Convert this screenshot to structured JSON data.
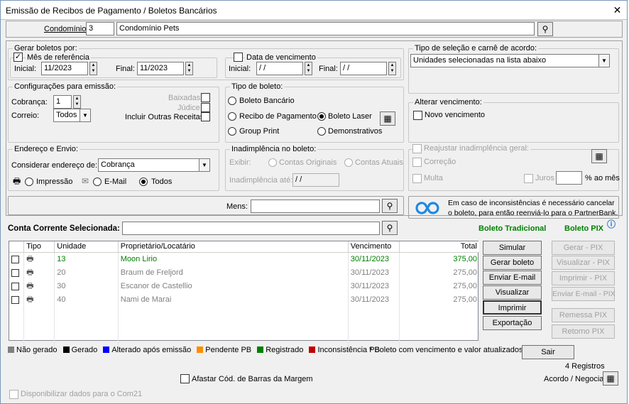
{
  "window": {
    "title": "Emissão de Recibos de Pagamento / Boletos Bancários"
  },
  "condominio": {
    "label": "Condomínio:",
    "code": "3",
    "name": "Condomínio Pets"
  },
  "gerar": {
    "title": "Gerar boletos por:",
    "mes_ref": {
      "label": "Mês de referência",
      "checked": true,
      "inicial_label": "Inicial:",
      "inicial": "11/2023",
      "final_label": "Final:",
      "final": "11/2023"
    },
    "data_venc": {
      "label": "Data de vencimento",
      "checked": false,
      "inicial_label": "Inicial:",
      "inicial": " / /",
      "final_label": "Final:",
      "final": " / /"
    }
  },
  "tipo_selecao": {
    "title": "Tipo de seleção e carnê de acordo:",
    "value": "Unidades selecionadas na lista abaixo"
  },
  "config": {
    "title": "Configurações para emissão:",
    "cobranca_label": "Cobrança:",
    "cobranca": "1",
    "correio_label": "Correio:",
    "correio": "Todos",
    "baixadas": "Baixadas",
    "judice": "Júdice",
    "outras": "Incluir Outras Receitas"
  },
  "tipo_boleto": {
    "title": "Tipo de boleto:",
    "opt1": "Boleto Bancário",
    "opt2": "Recibo de Pagamento",
    "opt3": "Boleto Laser",
    "opt4": "Group Print",
    "opt5": "Demonstrativos"
  },
  "alterar": {
    "title": "Alterar vencimento:",
    "novo": "Novo vencimento"
  },
  "endereco": {
    "title": "Endereço e Envio:",
    "considerar": "Considerar endereço de:",
    "value": "Cobrança",
    "impressao": "Impressão",
    "email": "E-Mail",
    "todos": "Todos"
  },
  "inad": {
    "title": "Inadimplência no boleto:",
    "exibir": "Exibir:",
    "originais": "Contas Originais",
    "atuais": "Contas Atuais",
    "ate_label": "Inadimplência até:",
    "ate": " / /"
  },
  "reajustar": {
    "title": "Reajustar inadimplência geral:",
    "correcao": "Correção",
    "multa": "Multa",
    "juros": "Juros",
    "pct": "% ao mês"
  },
  "mens": {
    "label": "Mens:",
    "value": ""
  },
  "info": {
    "text": "Em caso de inconsistências é necessário cancelar o boleto, para então reenviá-lo para o PartnerBank."
  },
  "conta": {
    "label": "Conta Corrente Selecionada:",
    "value": ""
  },
  "boleto_trad": "Boleto Tradicional",
  "boleto_pix": "Boleto PIX",
  "colors": {
    "green": "#008000",
    "gray": "#808080",
    "black": "#000000",
    "blue": "#0000ff",
    "orange": "#ff8c00",
    "red": "#c00000"
  },
  "table": {
    "headers": [
      "Tipo",
      "Unidade",
      "Proprietário/Locatário",
      "Vencimento",
      "Total"
    ],
    "rows": [
      {
        "unidade": "13",
        "nome": "Moon Lirio",
        "venc": "30/11/2023",
        "total": "375,00",
        "status": "green"
      },
      {
        "unidade": "20",
        "nome": "Braum de Freljord",
        "venc": "30/11/2023",
        "total": "275,00",
        "status": "gray"
      },
      {
        "unidade": "30",
        "nome": "Escanor de Castellio",
        "venc": "30/11/2023",
        "total": "275,00",
        "status": "gray"
      },
      {
        "unidade": "40",
        "nome": "Nami de Marai",
        "venc": "30/11/2023",
        "total": "275,00",
        "status": "gray"
      }
    ]
  },
  "buttons": {
    "simular": "Simular",
    "gerar": "Gerar boleto",
    "enviar": "Enviar E-mail",
    "visualizar": "Visualizar",
    "imprimir": "Imprimir",
    "exportacao": "Exportação",
    "gerar_pix": "Gerar - PIX",
    "visualizar_pix": "Visualizar - PIX",
    "imprimir_pix": "Imprimir - PIX",
    "enviar_pix": "Enviar E-mail - PIX",
    "remessa_pix": "Remessa PIX",
    "retorno_pix": "Retorno PIX",
    "sair": "Sair"
  },
  "legend": {
    "nao_gerado": "Não gerado",
    "gerado": "Gerado",
    "alterado": "Alterado após emissão",
    "pendente": "Pendente PB",
    "registrado": "Registrado",
    "inconsistencia": "Inconsistência PB",
    "note": "* Boleto com vencimento e valor atualizados."
  },
  "registros": "4 Registros",
  "acordo": "Acordo / Negociar",
  "afastar": "Afastar Cód. de Barras da Margem",
  "com21": "Disponibilizar dados para o Com21"
}
